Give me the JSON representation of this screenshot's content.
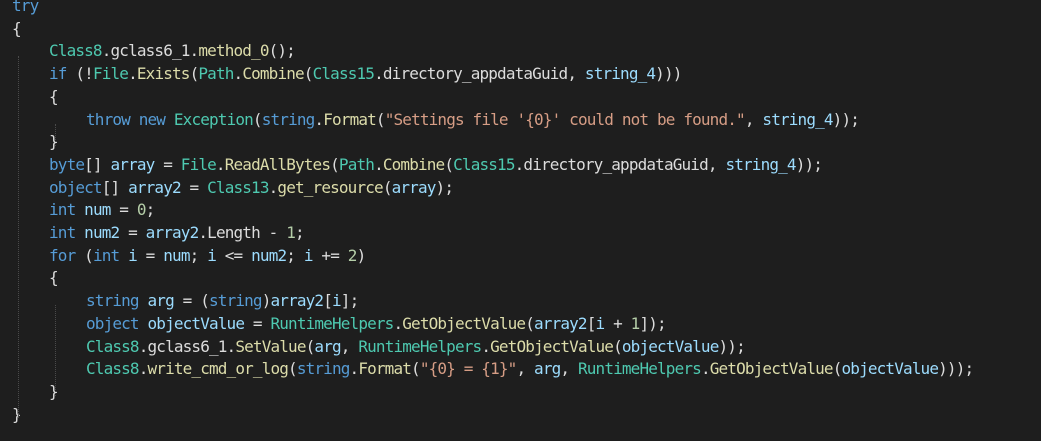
{
  "editor": {
    "lines": [
      {
        "indent": 0,
        "tokens": [
          {
            "c": "k",
            "t": "try"
          }
        ]
      },
      {
        "indent": 0,
        "tokens": [
          {
            "c": "p",
            "t": "{"
          }
        ]
      },
      {
        "indent": 1,
        "tokens": [
          {
            "c": "t",
            "t": "Class8"
          },
          {
            "c": "p",
            "t": "."
          },
          {
            "c": "f",
            "t": "gclass6_1"
          },
          {
            "c": "p",
            "t": "."
          },
          {
            "c": "m",
            "t": "method_0"
          },
          {
            "c": "p",
            "t": "();"
          }
        ]
      },
      {
        "indent": 1,
        "tokens": [
          {
            "c": "k",
            "t": "if"
          },
          {
            "c": "p",
            "t": " (!"
          },
          {
            "c": "t",
            "t": "File"
          },
          {
            "c": "p",
            "t": "."
          },
          {
            "c": "m",
            "t": "Exists"
          },
          {
            "c": "p",
            "t": "("
          },
          {
            "c": "t",
            "t": "Path"
          },
          {
            "c": "p",
            "t": "."
          },
          {
            "c": "m",
            "t": "Combine"
          },
          {
            "c": "p",
            "t": "("
          },
          {
            "c": "t",
            "t": "Class15"
          },
          {
            "c": "p",
            "t": "."
          },
          {
            "c": "f",
            "t": "directory_appdataGuid"
          },
          {
            "c": "p",
            "t": ", "
          },
          {
            "c": "v",
            "t": "string_4"
          },
          {
            "c": "p",
            "t": ")))"
          }
        ]
      },
      {
        "indent": 1,
        "tokens": [
          {
            "c": "p",
            "t": "{"
          }
        ]
      },
      {
        "indent": 2,
        "tokens": [
          {
            "c": "k",
            "t": "throw"
          },
          {
            "c": "p",
            "t": " "
          },
          {
            "c": "k",
            "t": "new"
          },
          {
            "c": "p",
            "t": " "
          },
          {
            "c": "t",
            "t": "Exception"
          },
          {
            "c": "p",
            "t": "("
          },
          {
            "c": "k",
            "t": "string"
          },
          {
            "c": "p",
            "t": "."
          },
          {
            "c": "m",
            "t": "Format"
          },
          {
            "c": "p",
            "t": "("
          },
          {
            "c": "s",
            "t": "\"Settings file '{0}' could not be found.\""
          },
          {
            "c": "p",
            "t": ", "
          },
          {
            "c": "v",
            "t": "string_4"
          },
          {
            "c": "p",
            "t": "));"
          }
        ]
      },
      {
        "indent": 1,
        "tokens": [
          {
            "c": "p",
            "t": "}"
          }
        ]
      },
      {
        "indent": 1,
        "tokens": [
          {
            "c": "k",
            "t": "byte"
          },
          {
            "c": "p",
            "t": "[] "
          },
          {
            "c": "v",
            "t": "array"
          },
          {
            "c": "p",
            "t": " = "
          },
          {
            "c": "t",
            "t": "File"
          },
          {
            "c": "p",
            "t": "."
          },
          {
            "c": "m",
            "t": "ReadAllBytes"
          },
          {
            "c": "p",
            "t": "("
          },
          {
            "c": "t",
            "t": "Path"
          },
          {
            "c": "p",
            "t": "."
          },
          {
            "c": "m",
            "t": "Combine"
          },
          {
            "c": "p",
            "t": "("
          },
          {
            "c": "t",
            "t": "Class15"
          },
          {
            "c": "p",
            "t": "."
          },
          {
            "c": "f",
            "t": "directory_appdataGuid"
          },
          {
            "c": "p",
            "t": ", "
          },
          {
            "c": "v",
            "t": "string_4"
          },
          {
            "c": "p",
            "t": "));"
          }
        ]
      },
      {
        "indent": 1,
        "tokens": [
          {
            "c": "k",
            "t": "object"
          },
          {
            "c": "p",
            "t": "[] "
          },
          {
            "c": "v",
            "t": "array2"
          },
          {
            "c": "p",
            "t": " = "
          },
          {
            "c": "t",
            "t": "Class13"
          },
          {
            "c": "p",
            "t": "."
          },
          {
            "c": "m",
            "t": "get_resource"
          },
          {
            "c": "p",
            "t": "("
          },
          {
            "c": "v",
            "t": "array"
          },
          {
            "c": "p",
            "t": ");"
          }
        ]
      },
      {
        "indent": 1,
        "tokens": [
          {
            "c": "k",
            "t": "int"
          },
          {
            "c": "p",
            "t": " "
          },
          {
            "c": "v",
            "t": "num"
          },
          {
            "c": "p",
            "t": " = "
          },
          {
            "c": "n",
            "t": "0"
          },
          {
            "c": "p",
            "t": ";"
          }
        ]
      },
      {
        "indent": 1,
        "tokens": [
          {
            "c": "k",
            "t": "int"
          },
          {
            "c": "p",
            "t": " "
          },
          {
            "c": "v",
            "t": "num2"
          },
          {
            "c": "p",
            "t": " = "
          },
          {
            "c": "v",
            "t": "array2"
          },
          {
            "c": "p",
            "t": "."
          },
          {
            "c": "pr",
            "t": "Length"
          },
          {
            "c": "p",
            "t": " - "
          },
          {
            "c": "n",
            "t": "1"
          },
          {
            "c": "p",
            "t": ";"
          }
        ]
      },
      {
        "indent": 1,
        "tokens": [
          {
            "c": "k",
            "t": "for"
          },
          {
            "c": "p",
            "t": " ("
          },
          {
            "c": "k",
            "t": "int"
          },
          {
            "c": "p",
            "t": " "
          },
          {
            "c": "v",
            "t": "i"
          },
          {
            "c": "p",
            "t": " = "
          },
          {
            "c": "v",
            "t": "num"
          },
          {
            "c": "p",
            "t": "; "
          },
          {
            "c": "v",
            "t": "i"
          },
          {
            "c": "p",
            "t": " <= "
          },
          {
            "c": "v",
            "t": "num2"
          },
          {
            "c": "p",
            "t": "; "
          },
          {
            "c": "v",
            "t": "i"
          },
          {
            "c": "p",
            "t": " += "
          },
          {
            "c": "n",
            "t": "2"
          },
          {
            "c": "p",
            "t": ")"
          }
        ]
      },
      {
        "indent": 1,
        "tokens": [
          {
            "c": "p",
            "t": "{"
          }
        ]
      },
      {
        "indent": 2,
        "tokens": [
          {
            "c": "k",
            "t": "string"
          },
          {
            "c": "p",
            "t": " "
          },
          {
            "c": "v",
            "t": "arg"
          },
          {
            "c": "p",
            "t": " = ("
          },
          {
            "c": "k",
            "t": "string"
          },
          {
            "c": "p",
            "t": ")"
          },
          {
            "c": "v",
            "t": "array2"
          },
          {
            "c": "p",
            "t": "["
          },
          {
            "c": "v",
            "t": "i"
          },
          {
            "c": "p",
            "t": "];"
          }
        ]
      },
      {
        "indent": 2,
        "tokens": [
          {
            "c": "k",
            "t": "object"
          },
          {
            "c": "p",
            "t": " "
          },
          {
            "c": "v",
            "t": "objectValue"
          },
          {
            "c": "p",
            "t": " = "
          },
          {
            "c": "t",
            "t": "RuntimeHelpers"
          },
          {
            "c": "p",
            "t": "."
          },
          {
            "c": "m",
            "t": "GetObjectValue"
          },
          {
            "c": "p",
            "t": "("
          },
          {
            "c": "v",
            "t": "array2"
          },
          {
            "c": "p",
            "t": "["
          },
          {
            "c": "v",
            "t": "i"
          },
          {
            "c": "p",
            "t": " + "
          },
          {
            "c": "n",
            "t": "1"
          },
          {
            "c": "p",
            "t": "]);"
          }
        ]
      },
      {
        "indent": 2,
        "tokens": [
          {
            "c": "t",
            "t": "Class8"
          },
          {
            "c": "p",
            "t": "."
          },
          {
            "c": "f",
            "t": "gclass6_1"
          },
          {
            "c": "p",
            "t": "."
          },
          {
            "c": "m",
            "t": "SetValue"
          },
          {
            "c": "p",
            "t": "("
          },
          {
            "c": "v",
            "t": "arg"
          },
          {
            "c": "p",
            "t": ", "
          },
          {
            "c": "t",
            "t": "RuntimeHelpers"
          },
          {
            "c": "p",
            "t": "."
          },
          {
            "c": "m",
            "t": "GetObjectValue"
          },
          {
            "c": "p",
            "t": "("
          },
          {
            "c": "v",
            "t": "objectValue"
          },
          {
            "c": "p",
            "t": "));"
          }
        ]
      },
      {
        "indent": 2,
        "tokens": [
          {
            "c": "t",
            "t": "Class8"
          },
          {
            "c": "p",
            "t": "."
          },
          {
            "c": "m",
            "t": "write_cmd_or_log"
          },
          {
            "c": "p",
            "t": "("
          },
          {
            "c": "k",
            "t": "string"
          },
          {
            "c": "p",
            "t": "."
          },
          {
            "c": "m",
            "t": "Format"
          },
          {
            "c": "p",
            "t": "("
          },
          {
            "c": "s",
            "t": "\"{0} = {1}\""
          },
          {
            "c": "p",
            "t": ", "
          },
          {
            "c": "v",
            "t": "arg"
          },
          {
            "c": "p",
            "t": ", "
          },
          {
            "c": "t",
            "t": "RuntimeHelpers"
          },
          {
            "c": "p",
            "t": "."
          },
          {
            "c": "m",
            "t": "GetObjectValue"
          },
          {
            "c": "p",
            "t": "("
          },
          {
            "c": "v",
            "t": "objectValue"
          },
          {
            "c": "p",
            "t": ")));"
          }
        ]
      },
      {
        "indent": 1,
        "tokens": [
          {
            "c": "p",
            "t": "}"
          }
        ]
      },
      {
        "indent": 0,
        "tokens": [
          {
            "c": "p",
            "t": "}"
          }
        ]
      }
    ]
  },
  "colors": {
    "background": "#1e1e1e",
    "keyword": "#569cd6",
    "type": "#4ec9b0",
    "string": "#d69d85",
    "number": "#b5cea8",
    "variable": "#9cdcfe",
    "method": "#dcdcaa",
    "plain": "#dcdcdc"
  }
}
